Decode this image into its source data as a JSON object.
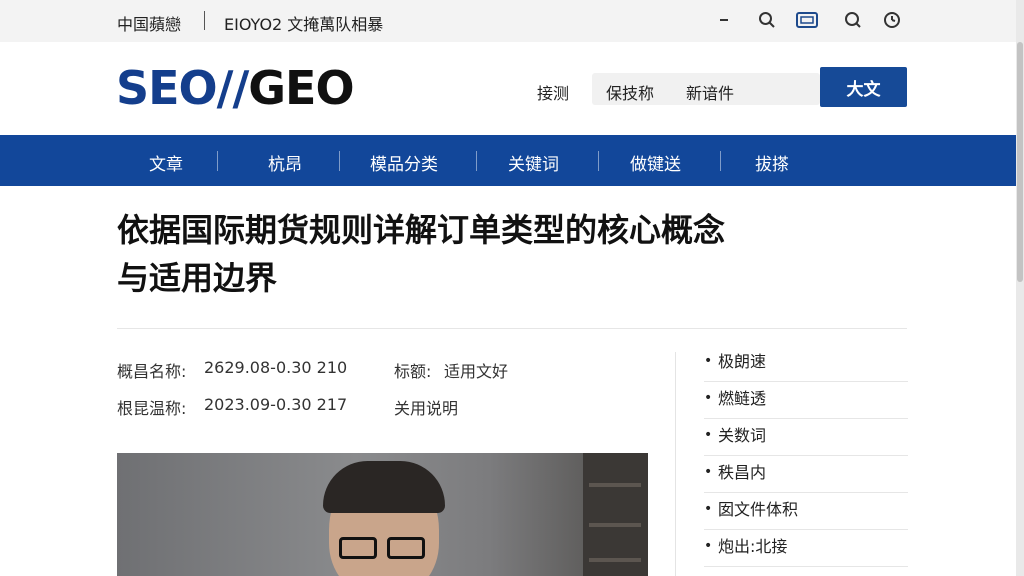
{
  "topbar": {
    "brand": "中国蘋戀",
    "tagline": "EIOYO2 文掩萬队相暴",
    "icons": [
      "minus-icon",
      "search-icon",
      "screen-icon",
      "search-icon",
      "clock-icon"
    ]
  },
  "header": {
    "logo_seo": "SEO//",
    "logo_geo": "GEO",
    "link1": "接测",
    "search_text_1": "保技称",
    "search_text_2": "新谙件",
    "button": "大文"
  },
  "nav": {
    "items": [
      {
        "label": "文章"
      },
      {
        "label": "杭昂"
      },
      {
        "label": "模品分类"
      },
      {
        "label": "关键词"
      },
      {
        "label": "做键送"
      },
      {
        "label": "拔搽"
      }
    ]
  },
  "article": {
    "title_line1": "依据国际期货规则详解订单类型的核心概念",
    "title_line2": "与适用边界",
    "meta": {
      "row1_label": "概昌名称:",
      "row1_value": "2629.08-0.30  210",
      "row1_tag_label": "标额:",
      "row1_tag_value": "适用文好",
      "row2_label": "根昆温称:",
      "row2_value": "2023.09-0.30  217",
      "row2_tag": "关用说明"
    }
  },
  "sidebar": {
    "items": [
      {
        "label": "极朗速"
      },
      {
        "label": "燃鲢透"
      },
      {
        "label": "关数词"
      },
      {
        "label": "秩昌内"
      },
      {
        "label": "囡文件体积"
      },
      {
        "label": "炮出:北接"
      }
    ]
  },
  "colors": {
    "brand_blue": "#143e8c",
    "nav_blue": "#12479a",
    "button_blue": "#164a97"
  }
}
